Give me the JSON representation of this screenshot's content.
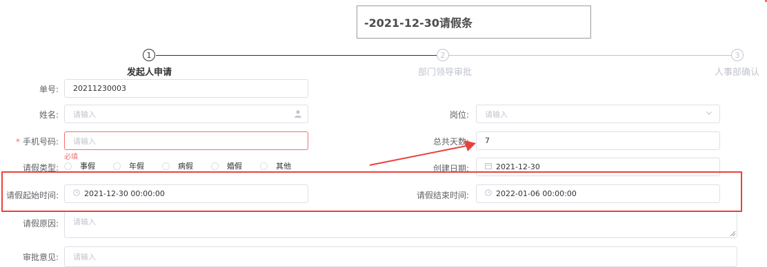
{
  "page_title": "-2021-12-30请假条",
  "steps": [
    {
      "number": "1",
      "title": "发起人申请"
    },
    {
      "number": "2",
      "title": "部门领导审批"
    },
    {
      "number": "3",
      "title": "人事部确认"
    }
  ],
  "form": {
    "order_no": {
      "label": "单号:",
      "value": "20211230003"
    },
    "name": {
      "label": "姓名:",
      "placeholder": "请输入"
    },
    "position": {
      "label": "岗位:",
      "placeholder": "请输入"
    },
    "phone": {
      "label": "手机号码:",
      "placeholder": "请输入",
      "error": "必填"
    },
    "total_days": {
      "label": "总共天数:",
      "value": "7"
    },
    "leave_type": {
      "label": "请假类型:",
      "options": [
        "事假",
        "年假",
        "病假",
        "婚假",
        "其他"
      ]
    },
    "created_date": {
      "label": "创建日期:",
      "value": "2021-12-30"
    },
    "start_time": {
      "label": "请假起始时间:",
      "value": "2021-12-30 00:00:00"
    },
    "end_time": {
      "label": "请假结束时间:",
      "value": "2022-01-06 00:00:00"
    },
    "reason": {
      "label": "请假原因:",
      "placeholder": "请输入"
    },
    "approval": {
      "label": "审批意见:",
      "placeholder": "请输入"
    }
  },
  "colors": {
    "highlight": "#e8413b",
    "error": "#f56c6c",
    "active_step": "#303133"
  }
}
